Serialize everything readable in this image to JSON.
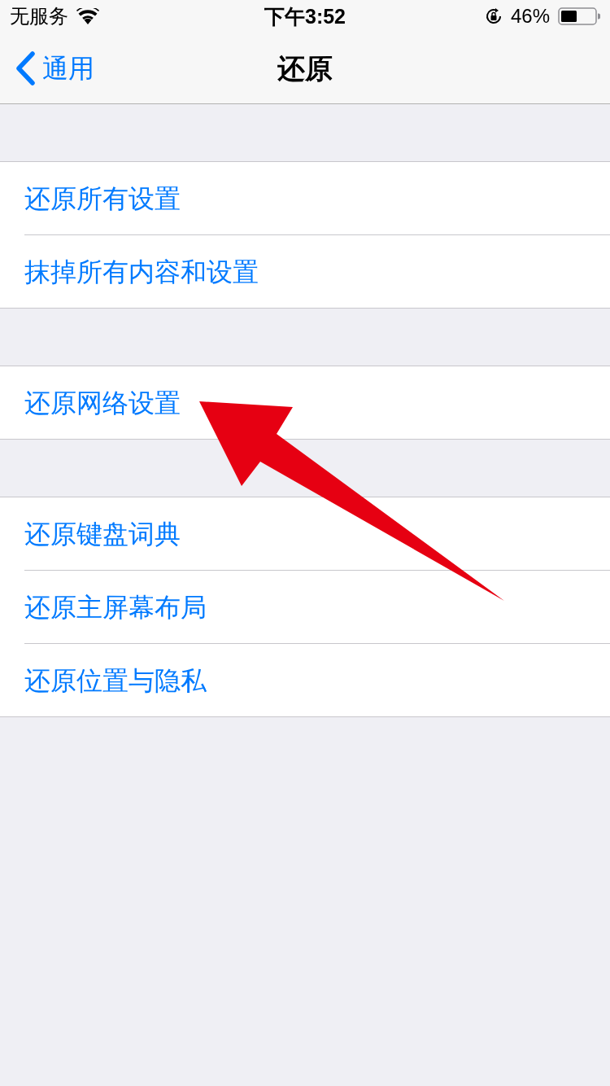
{
  "status_bar": {
    "carrier": "无服务",
    "time": "下午3:52",
    "battery_percent": "46%"
  },
  "nav_bar": {
    "back_label": "通用",
    "title": "还原"
  },
  "groups": [
    {
      "items": [
        {
          "label": "还原所有设置"
        },
        {
          "label": "抹掉所有内容和设置"
        }
      ]
    },
    {
      "items": [
        {
          "label": "还原网络设置"
        }
      ]
    },
    {
      "items": [
        {
          "label": "还原键盘词典"
        },
        {
          "label": "还原主屏幕布局"
        },
        {
          "label": "还原位置与隐私"
        }
      ]
    }
  ]
}
